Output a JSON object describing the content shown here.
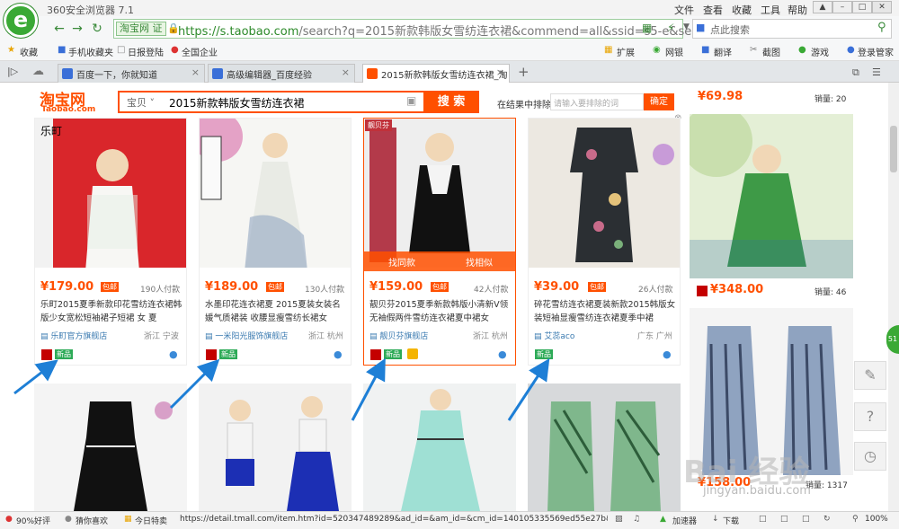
{
  "browser": {
    "title": "360安全浏览器 7.1",
    "menu": [
      "文件",
      "查看",
      "收藏",
      "工具",
      "帮助"
    ],
    "url_badge": "淘宝网 证",
    "url_prefix": "https://s.taobao.com",
    "url_rest": "/search?q=2015新款韩版女雪纺连衣裙&commend=all&ssid=s5-e&sea",
    "search_placeholder": "点此搜索",
    "bookmarks": [
      "收藏",
      "手机收藏夹",
      "日报登陆",
      "全国企业"
    ],
    "right_tools": [
      "扩展",
      "网银",
      "翻译",
      "截图",
      "游戏",
      "登录管家"
    ],
    "tabs": [
      {
        "label": "百度一下，你就知道"
      },
      {
        "label": "高级编辑器_百度经验"
      },
      {
        "label": "2015新款韩版女雪纺连衣裙_淘"
      }
    ]
  },
  "taobao": {
    "logo": "淘宝网",
    "logo_sub": "Taobao.com",
    "category": "宝贝",
    "query": "2015新款韩版女雪纺连衣裙",
    "search_button": "搜 索",
    "in_result_label": "在结果中排除",
    "in_result_placeholder": "请输入要排除的词",
    "ok_button": "确定"
  },
  "products": [
    {
      "price": "¥179.00",
      "baoyou": "包邮",
      "paid": "190人付款",
      "title": "乐町2015夏季新款印花雪纺连衣裙韩版少女宽松短袖裙子短裙 女 夏",
      "shop": "乐町官方旗舰店",
      "loc": "浙江 宁波",
      "new": "新品"
    },
    {
      "price": "¥189.00",
      "baoyou": "包邮",
      "paid": "130人付款",
      "title": "水墨印花连衣裙夏 2015夏装女装名媛气质裙装 收腰显瘦雪纺长裙女",
      "shop": "一米阳光服饰旗舰店",
      "loc": "浙江 杭州",
      "new": "新品"
    },
    {
      "price": "¥159.00",
      "baoyou": "包邮",
      "paid": "42人付款",
      "title": "靓贝芬2015夏季新款韩版小清新V领无袖假两件雪纺连衣裙夏中裙女",
      "shop": "靓贝芬旗舰店",
      "loc": "浙江 杭州",
      "new": "新品",
      "btn1": "找同款",
      "btn2": "找相似",
      "brand": "靓贝芬"
    },
    {
      "price": "¥39.00",
      "baoyou": "包邮",
      "paid": "26人付款",
      "title": "碎花雪纺连衣裙夏装新款2015韩版女装短袖显瘦雪纺连衣裙夏季中裙",
      "shop": "艾蕊aco",
      "loc": "广东 广州",
      "new": "新品"
    }
  ],
  "right_column": [
    {
      "price": "¥69.98",
      "sold": "销量: 20"
    },
    {
      "price": "¥348.00",
      "sold": "销量: 46"
    },
    {
      "price": "¥158.00",
      "sold": "销量: 1317"
    }
  ],
  "watermark": "Bai 经验",
  "watermark_sub": "jingyan.baidu.com",
  "status": {
    "rating": "90%好评",
    "guess": "猜你喜欢",
    "today": "今日特卖",
    "url": "https://detail.tmall.com/item.htm?id=520347489289&ad_id=&am_id=&cm_id=140105335569ed55e27b&p",
    "accelerator": "加速器",
    "download": "下载",
    "zoom": "100%"
  },
  "colors": {
    "accent": "#ff5000",
    "browser_green": "#3aa935",
    "arrow": "#1e7fd6"
  }
}
